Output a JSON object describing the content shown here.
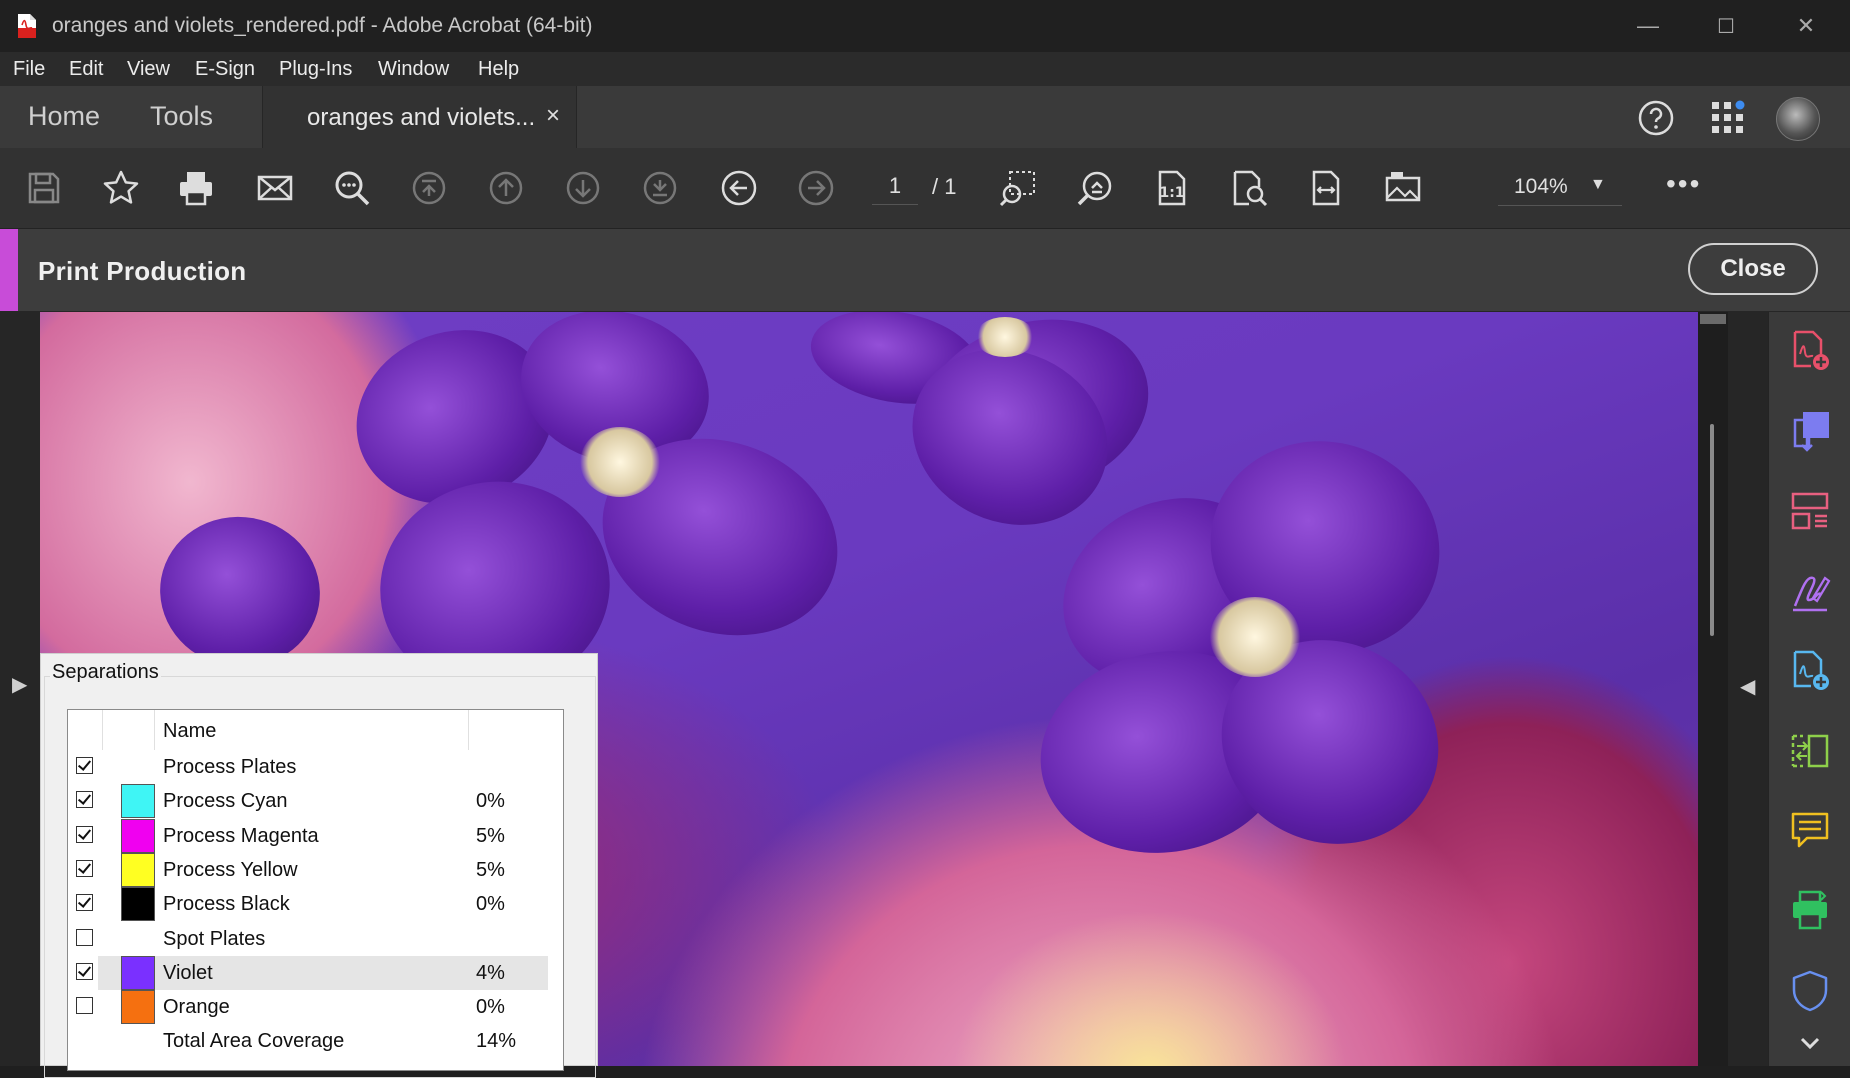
{
  "window": {
    "title": "oranges and violets_rendered.pdf - Adobe Acrobat (64-bit)",
    "controls": {
      "minimize": "—",
      "maximize": "☐",
      "close": "✕"
    }
  },
  "menu": [
    "File",
    "Edit",
    "View",
    "E-Sign",
    "Plug-Ins",
    "Window",
    "Help"
  ],
  "tabs": {
    "home": "Home",
    "tools": "Tools",
    "document": "oranges and violets...",
    "close": "×"
  },
  "toolbar": {
    "page_current": "1",
    "page_total": "/ 1",
    "zoom": "104%",
    "more": "•••",
    "icons": [
      "save-icon",
      "bookmark-star-icon",
      "print-icon",
      "email-icon",
      "search-icon",
      "first-page-icon",
      "prev-page-icon",
      "next-page-icon",
      "last-page-icon",
      "back-icon",
      "forward-icon",
      "marquee-zoom-icon",
      "zoom-icon",
      "actual-size-icon",
      "fit-page-icon",
      "fit-width-icon",
      "reading-mode-icon"
    ]
  },
  "print_production": {
    "title": "Print Production",
    "close": "Close",
    "accent": "#c84cd8"
  },
  "separations": {
    "title": "Separations",
    "header": "Name",
    "rows": [
      {
        "name": "Process Plates",
        "checked": true,
        "swatch": null,
        "value": ""
      },
      {
        "name": "Process Cyan",
        "checked": true,
        "swatch": "#3ff5f5",
        "value": "0%"
      },
      {
        "name": "Process Magenta",
        "checked": true,
        "swatch": "#f000f0",
        "value": "5%"
      },
      {
        "name": "Process Yellow",
        "checked": true,
        "swatch": "#ffff22",
        "value": "5%"
      },
      {
        "name": "Process Black",
        "checked": true,
        "swatch": "#000000",
        "value": "0%"
      },
      {
        "name": "Spot Plates",
        "checked": false,
        "swatch": null,
        "value": ""
      },
      {
        "name": "Violet",
        "checked": true,
        "swatch": "#7a30ff",
        "value": "4%",
        "selected": true
      },
      {
        "name": "Orange",
        "checked": false,
        "swatch": "#f57010",
        "value": "0%"
      },
      {
        "name": "Total Area Coverage",
        "checked": null,
        "swatch": null,
        "value": "14%"
      }
    ]
  },
  "right_rail": {
    "icons": [
      {
        "name": "create-pdf-icon",
        "color": "#e8506a"
      },
      {
        "name": "export-pdf-icon",
        "color": "#7c7cf0"
      },
      {
        "name": "organize-pages-icon",
        "color": "#e86080"
      },
      {
        "name": "fill-sign-icon",
        "color": "#b070f0"
      },
      {
        "name": "edit-pdf-icon",
        "color": "#58b8f0"
      },
      {
        "name": "compare-icon",
        "color": "#8ed04a"
      },
      {
        "name": "comment-icon",
        "color": "#f0c020"
      },
      {
        "name": "print-production-icon",
        "color": "#30c060"
      },
      {
        "name": "protect-icon",
        "color": "#6890f0"
      }
    ]
  }
}
